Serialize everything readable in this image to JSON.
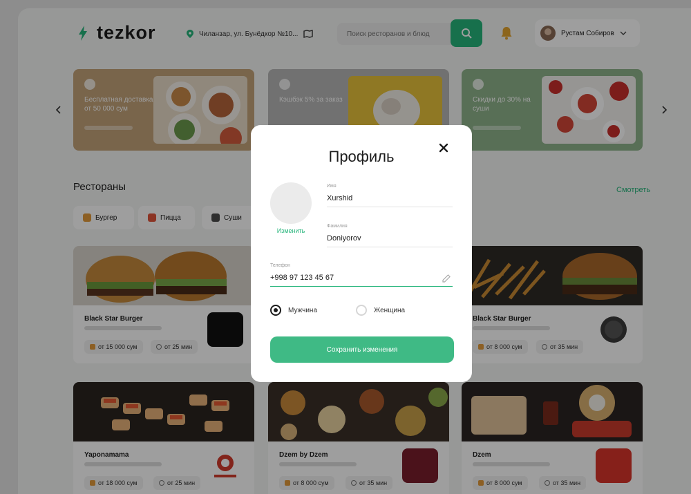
{
  "header": {
    "logo": "tezkor",
    "address": "Чиланзар, ул. Бунёдкор №10...",
    "search_placeholder": "Поиск ресторанов и блюд",
    "user_name": "Рустам Собиров"
  },
  "banners": [
    {
      "text": "Бесплатная доставка от 50 000 сум"
    },
    {
      "text": "Кэшбэк 5% за заказ"
    },
    {
      "text": "Скидки до 30% на суши"
    }
  ],
  "section": {
    "title": "Рестораны",
    "see_all": "Смотреть"
  },
  "chips": [
    {
      "label": "Бургер"
    },
    {
      "label": "Пицца"
    },
    {
      "label": "Суши"
    }
  ],
  "cards": [
    {
      "name": "Black Star Burger",
      "price": "от 15 000 сум",
      "time": "от 25 мин"
    },
    {
      "name": "Black Star Burger",
      "price": "от 8 000 сум",
      "time": "от 35 мин"
    },
    {
      "name": "Yaponamama",
      "price": "от 18 000 сум",
      "time": "от 25 мин"
    },
    {
      "name": "Dzem by Dzem",
      "price": "от 8 000 сум",
      "time": "от 35 мин"
    },
    {
      "name": "Dzem",
      "price": "от 8 000 сум",
      "time": "от 35 мин"
    }
  ],
  "modal": {
    "title": "Профиль",
    "change_photo": "Изменить",
    "first_name_label": "Имя",
    "first_name": "Xurshid",
    "last_name_label": "Фамилия",
    "last_name": "Doniyorov",
    "phone_label": "Телефон",
    "phone": "+998 97 123 45 67",
    "gender_male": "Мужчина",
    "gender_female": "Женщина",
    "selected_gender": "male",
    "save_label": "Сохранить изменения"
  },
  "colors": {
    "accent": "#26b57b",
    "overlay": "rgba(0,0,0,0.38)"
  }
}
